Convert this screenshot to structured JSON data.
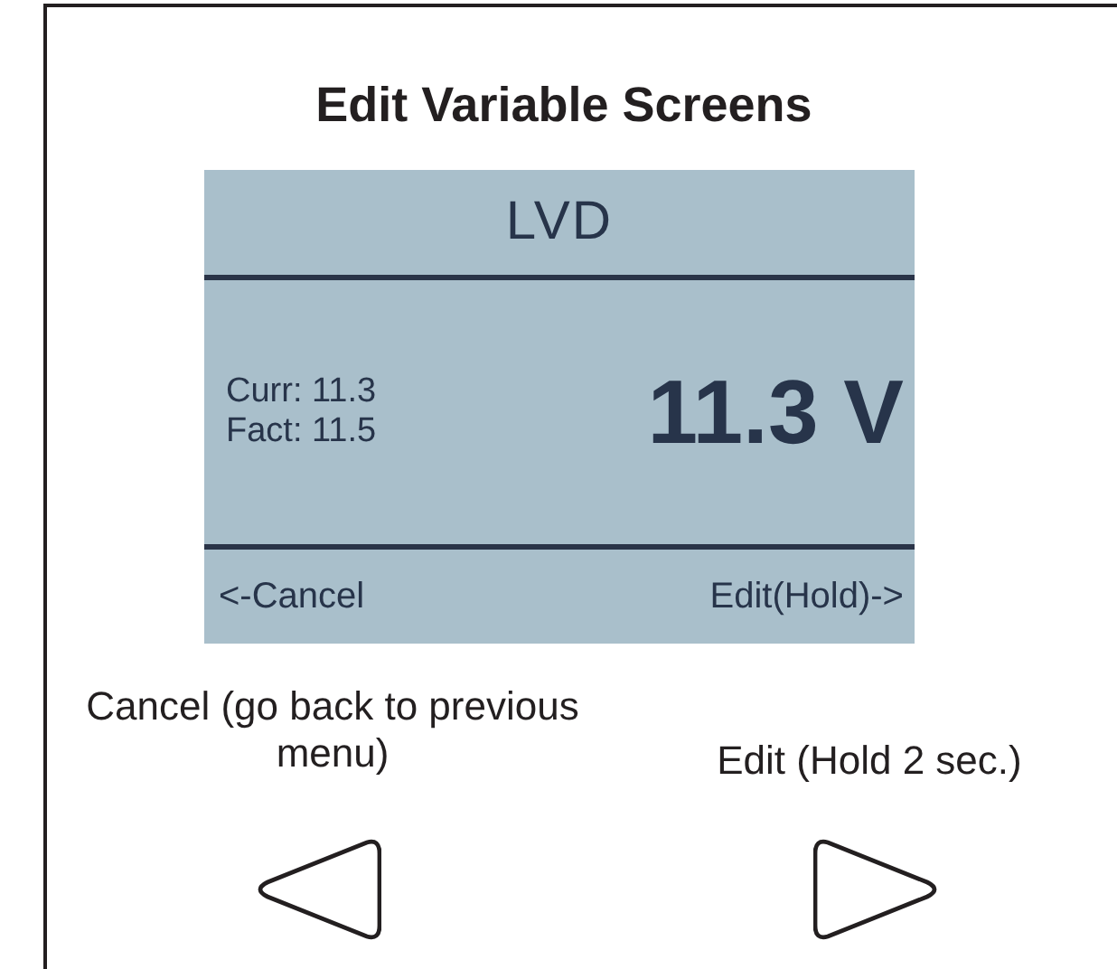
{
  "title": "Edit Variable Screens",
  "lcd": {
    "header": "LVD",
    "readings": [
      "Curr: 11.3",
      "Fact: 11.5"
    ],
    "value": "11.3 V",
    "footer_left": "<-Cancel",
    "footer_right": "Edit(Hold)->"
  },
  "buttons": [
    {
      "kind": "left",
      "caption": "Cancel (go back to previous menu)"
    },
    {
      "kind": "right",
      "caption": "Edit (Hold 2 sec.)"
    }
  ]
}
